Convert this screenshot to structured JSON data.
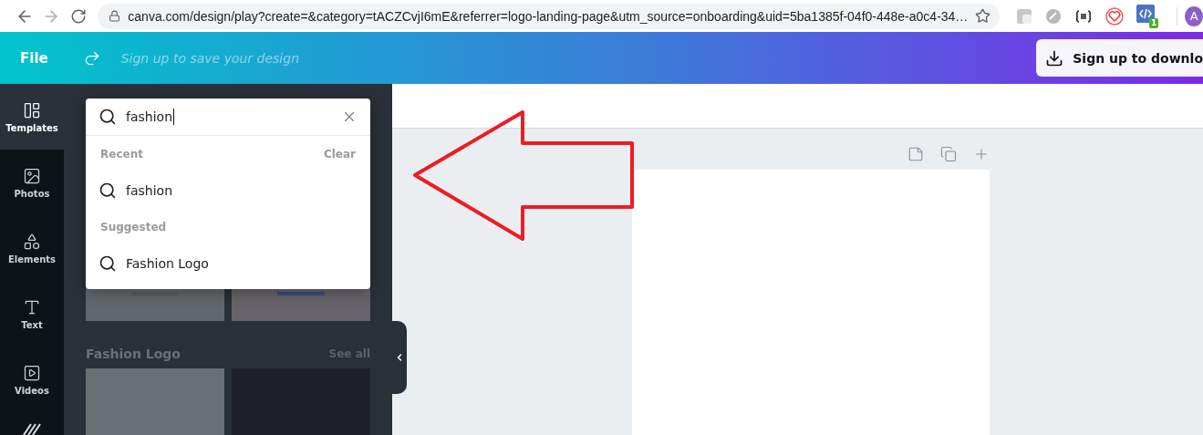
{
  "browser": {
    "url": "canva.com/design/play?create=&category=tACZCvjI6mE&referrer=logo-landing-page&utm_source=onboarding&uid=5ba1385f-04f0-448e-a0c4-34…",
    "forward_disabled": true,
    "extension_badge": "1",
    "profile_initial": "A"
  },
  "header": {
    "menu": "File",
    "title_placeholder": "Sign up to save your design",
    "download_button": "Sign up to downlo"
  },
  "sidebar": {
    "items": [
      {
        "kind": "templates",
        "label": "Templates",
        "selected": true
      },
      {
        "kind": "photos",
        "label": "Photos",
        "selected": false
      },
      {
        "kind": "elements",
        "label": "Elements",
        "selected": false
      },
      {
        "kind": "text",
        "label": "Text",
        "selected": false
      },
      {
        "kind": "videos",
        "label": "Videos",
        "selected": false
      },
      {
        "kind": "background",
        "selected": false
      }
    ]
  },
  "search": {
    "value": "fashion",
    "sections": [
      {
        "title": "Recent",
        "action": "Clear",
        "items": [
          "fashion"
        ]
      },
      {
        "title": "Suggested",
        "items": [
          "Fashion Logo"
        ]
      }
    ]
  },
  "results": {
    "heading": "Fashion Logo",
    "link": "See all"
  }
}
